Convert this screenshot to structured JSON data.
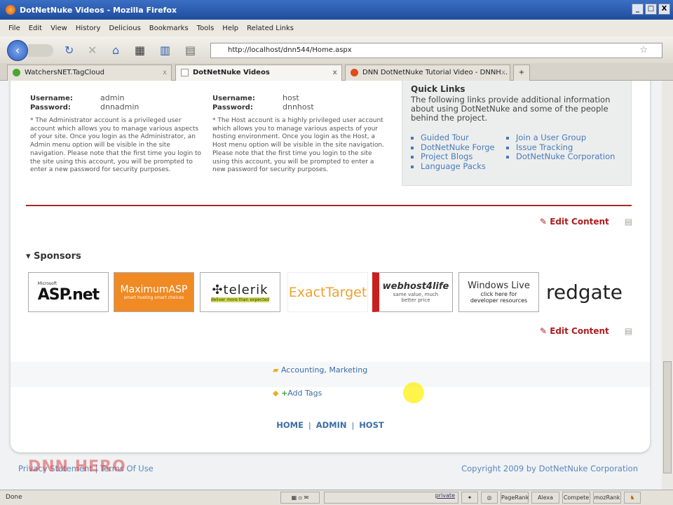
{
  "window": {
    "title": "DotNetNuke Videos - Mozilla Firefox"
  },
  "menu": [
    "File",
    "Edit",
    "View",
    "History",
    "Delicious",
    "Bookmarks",
    "Tools",
    "Help",
    "Related Links"
  ],
  "url": "http://localhost/dnn544/Home.aspx",
  "tabs": [
    {
      "label": "WatchersNET.TagCloud"
    },
    {
      "label": "DotNetNuke Videos"
    },
    {
      "label": "DNN DotNetNuke Tutorial Video - DNNH..."
    }
  ],
  "admin": {
    "username_label": "Username:",
    "username": "admin",
    "password_label": "Password:",
    "password": "dnnadmin",
    "desc": "* The Administrator account is a privileged user account which allows you to manage various aspects of your site. Once you login as the Administrator, an Admin menu option will be visible in the site navigation. Please note that the first time you login to the site using this account, you will be prompted to enter a new password for security purposes."
  },
  "host": {
    "username_label": "Username:",
    "username": "host",
    "password_label": "Password:",
    "password": "dnnhost",
    "desc": "* The Host account is a highly privileged user account which allows you to manage various aspects of your hosting environment. Once you login as the Host, a Host menu option will be visible in the site navigation. Please note that the first time you login to the site using this account, you will be prompted to enter a new password for security purposes."
  },
  "quicklinks": {
    "title": "Quick Links",
    "desc": "The following links provide additional information about using DotNetNuke and some of the people behind the project.",
    "col1": [
      "Guided Tour",
      "DotNetNuke Forge",
      "Project Blogs",
      "Language Packs"
    ],
    "col2": [
      "Join a User Group",
      "Issue Tracking",
      "DotNetNuke Corporation"
    ]
  },
  "edit_content": "Edit Content",
  "sponsors": {
    "title": "Sponsors",
    "logos": [
      "ASP.net",
      "MaximumASP",
      "telerik",
      "ExactTarget",
      "webhost4life",
      "Windows Live",
      "redgate"
    ],
    "maxasp_sub": "smart hosting smart choices",
    "telerik_sub": "deliver more than expected",
    "webhost_sub": "same value, much better price",
    "wl_sub": "click here for developer resources",
    "ms": "Microsoft"
  },
  "tags": {
    "categories": "Accounting, Marketing",
    "add": "Add Tags"
  },
  "footer_nav": [
    "HOME",
    "ADMIN",
    "HOST"
  ],
  "footer": {
    "left": "Privacy Statement | Terms Of Use",
    "copyright": "Copyright 2009 by DotNetNuke Corporation",
    "watermark": "DNN HERO"
  },
  "status": {
    "text": "Done",
    "private": "private",
    "items": [
      "PageRank",
      "Alexa",
      "Compete",
      "mozRank"
    ]
  }
}
